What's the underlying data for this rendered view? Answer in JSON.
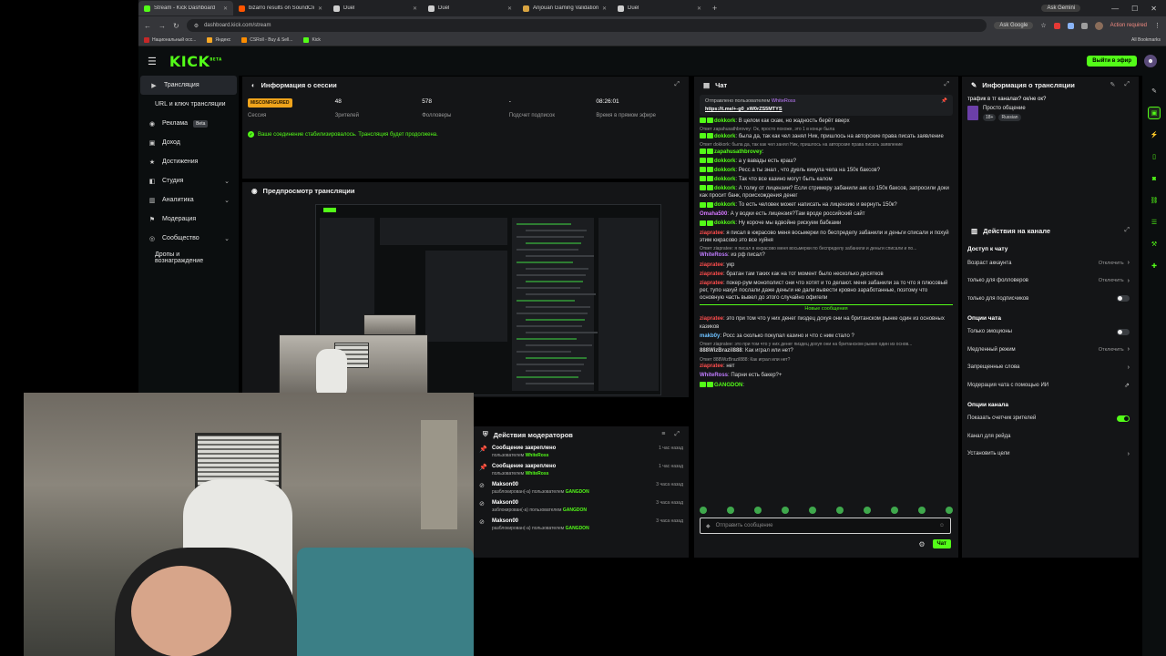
{
  "browser": {
    "tabs": [
      {
        "label": "Stream - Kick Dashboard",
        "color": "#53fc18",
        "active": true
      },
      {
        "label": "bizarro results on SoundCloud",
        "color": "#ff5500",
        "active": false
      },
      {
        "label": "Duel",
        "color": "#cfcfcf",
        "active": false
      },
      {
        "label": "Duel",
        "color": "#cfcfcf",
        "active": false
      },
      {
        "label": "Anjouan Gaming Validation Re...",
        "color": "#d9a441",
        "active": false
      },
      {
        "label": "Duel",
        "color": "#cfcfcf",
        "active": false
      }
    ],
    "url": "dashboard.kick.com/stream",
    "ask_gemini": "Ask Gemini",
    "ask_google": "Ask Google",
    "action_required": "Action required",
    "bookmarks": [
      "Национальный осс...",
      "Яндекс",
      "CSRoll - Buy & Sell...",
      "Kick"
    ],
    "all_bookmarks": "All Bookmarks"
  },
  "header": {
    "logo": "KICK",
    "logo_beta": "BETA",
    "go_live": "Выйти в эфир"
  },
  "sidebar": {
    "items": [
      {
        "label": "Трансляция",
        "icon": "▶",
        "active": true
      },
      {
        "label": "URL и ключ трансляции",
        "icon": "",
        "sub": true
      },
      {
        "label": "Реклама",
        "icon": "◉",
        "badge": "Beta"
      },
      {
        "label": "Доход",
        "icon": "▣"
      },
      {
        "label": "Достижения",
        "icon": "★"
      },
      {
        "label": "Студия",
        "icon": "◧",
        "chev": true
      },
      {
        "label": "Аналитика",
        "icon": "▥",
        "chev": true
      },
      {
        "label": "Модерация",
        "icon": "⚑"
      },
      {
        "label": "Сообщество",
        "icon": "◎",
        "chev": true
      },
      {
        "label": "Дропы и вознаграждение",
        "icon": "",
        "sub": true
      }
    ]
  },
  "session": {
    "title": "Информация о сессии",
    "status": "MISCONFIGURED",
    "stats": [
      {
        "value": "48",
        "label": "Зрителей"
      },
      {
        "value": "578",
        "label": "Фолловеры"
      },
      {
        "value": "-",
        "label": "Подсчет подписок"
      },
      {
        "value": "08:26:01",
        "label": "Время в прямом эфире"
      }
    ],
    "session_label": "Сессия",
    "ok_message": "Ваше соединение стабилизировалось. Трансляция будет продолжена."
  },
  "preview": {
    "title": "Предпросмотр трансляции"
  },
  "mod_actions": {
    "title": "Действия модераторов",
    "rows": [
      {
        "icon": "📌",
        "title": "Сообщение закреплено",
        "sub": "пользователем",
        "user": "WhiteRoss",
        "time": "1 час назад"
      },
      {
        "icon": "📌",
        "title": "Сообщение закреплено",
        "sub": "пользователем",
        "user": "WhiteRoss",
        "time": "1 час назад"
      },
      {
        "icon": "⊘",
        "title": "Makson00",
        "sub": "разблокирован(-а) пользователем",
        "user": "GANGDON",
        "time": "3 часа назад"
      },
      {
        "icon": "⊘",
        "title": "Makson00",
        "sub": "заблокирован(-а) пользователем",
        "user": "GANGDON",
        "time": "3 часа назад"
      },
      {
        "icon": "⊘",
        "title": "Makson00",
        "sub": "разблокирован(-а) пользователем",
        "user": "GANGDON",
        "time": "3 часа назад"
      }
    ]
  },
  "chat": {
    "title": "Чат",
    "pinned_by": "Отправлено пользователем",
    "pinned_user": "WhiteRoss",
    "pinned_link": "https://t.me/+-g0_xW0rZS5MTYS",
    "new_messages": "Новые сообщения",
    "placeholder": "Отправить сообщение",
    "send": "Чат",
    "messages": [
      {
        "reply": "",
        "user": "dokkork",
        "color": "#53fc18",
        "text": "В целом как скам, но жадность берёт вверх"
      },
      {
        "reply": "Ответ zapahusathbrovey: Ок, просто похоже, это 1 в конце была",
        "user": "dokkork",
        "color": "#53fc18",
        "text": "была да, так как чел занял Ник, пришлось на авторские права писать заявление"
      },
      {
        "reply": "Ответ dokkork: была да, так как чел занял Ник, пришлось на авторские права писать заявление",
        "user": "zapahusathbrovey",
        "color": "#53fc18",
        "text": ""
      },
      {
        "reply": "",
        "user": "dokkork",
        "color": "#53fc18",
        "text": "а у вавады есть краш?"
      },
      {
        "reply": "",
        "user": "dokkork",
        "color": "#53fc18",
        "text": "Ресс а ты знал , что дуель кинула чела на 150к баксов?"
      },
      {
        "reply": "",
        "user": "dokkork",
        "color": "#53fc18",
        "text": "Так что все казино могут быть калом"
      },
      {
        "reply": "",
        "user": "dokkork",
        "color": "#53fc18",
        "text": "А толку от лицензии? Если стримеру забанили акк со 150к баксов, запросили доки как просит банк, происхождения денег"
      },
      {
        "reply": "",
        "user": "dokkork",
        "color": "#53fc18",
        "text": "То есть человек может написать на лицензию и вернуть 150к?"
      },
      {
        "reply": "",
        "user": "Omaha500",
        "color": "#d676ff",
        "text": "А у водки есть лицензия?Там вроде российский сайт"
      },
      {
        "reply": "",
        "user": "dokkork",
        "color": "#53fc18",
        "text": "Ну короче мы вдвойне рискуем бабками"
      },
      {
        "reply": "",
        "user": "ziapratee",
        "color": "#ff4d4d",
        "text": "я писал в юкрасово меня восьмерки по беспределу забанили и деньги списали и похуй этим юкрасово это все хуйня"
      },
      {
        "reply": "Ответ ziapratee: я писал в юкрасово меня восьмерки по беспределу забанили и деньги списали и по...",
        "user": "WhiteRoss",
        "color": "#c07cff",
        "text": "из рф писал?"
      },
      {
        "reply": "",
        "user": "ziapratee",
        "color": "#ff4d4d",
        "text": "укр"
      },
      {
        "reply": "",
        "user": "ziapratee",
        "color": "#ff4d4d",
        "text": "братан там таких как на тот момент было несколько десятков"
      },
      {
        "reply": "",
        "user": "ziapratee",
        "color": "#ff4d4d",
        "text": "покер-рум монополист они что хотят и то делают. меня забанили за то что я плюсовый рег, тупо нахуй послали даже деньги не дали вывести кровно заработанные, поэтому что основную часть вывел до этого случайно офигели"
      },
      {
        "divider": true
      },
      {
        "reply": "",
        "user": "ziapratee",
        "color": "#ff4d4d",
        "text": "это при том что у них денег пиздец дохуя они на британском рынке один из основных казиков"
      },
      {
        "reply": "",
        "user": "makb0y",
        "color": "#6ec1ff",
        "text": "Росс за сколько покупал казино и что с ним стало ?"
      },
      {
        "reply": "Ответ ziapratee: это при том что у них денег пиздец дохуя они на британском рынке один из основ...",
        "user": "888WizBrazil888",
        "color": "#cfcfcf",
        "text": "Как играл или нет?"
      },
      {
        "reply": "Ответ 888WizBrazil888: Как играл или нет?",
        "user": "ziapratee",
        "color": "#ff4d4d",
        "text": "нет"
      },
      {
        "reply": "",
        "user": "WhiteRoss",
        "color": "#c07cff",
        "text": "Парни есть бакер?+"
      },
      {
        "reply": "",
        "user": "GANGDON",
        "color": "#53fc18",
        "text": ""
      }
    ]
  },
  "stream_info": {
    "title": "Информация о трансляции",
    "stream_title": "трафик в тг каналах? ок/не ок?",
    "category": "Просто общение",
    "tags": [
      "18+",
      "Russian"
    ]
  },
  "channel_actions": {
    "title": "Действия на канале",
    "sections": [
      {
        "title": "Доступ к чату",
        "rows": [
          {
            "label": "Возраст аккаунта",
            "value": "Отключить",
            "kind": "chev"
          },
          {
            "label": "только для фолловеров",
            "value": "Отключить",
            "kind": "chev"
          },
          {
            "label": "только для подписчиков",
            "value": "",
            "kind": "toggle",
            "on": false
          }
        ]
      },
      {
        "title": "Опции чата",
        "rows": [
          {
            "label": "Только эмоционы",
            "value": "",
            "kind": "toggle",
            "on": false
          },
          {
            "label": "Медленный режим",
            "value": "Отключить",
            "kind": "chev"
          },
          {
            "label": "Запрещенные слова",
            "value": "",
            "kind": "chev"
          },
          {
            "label": "Модерация чата с помощью ИИ",
            "value": "",
            "kind": "ext"
          }
        ]
      },
      {
        "title": "Опции канала",
        "rows": [
          {
            "label": "Показать счетчик зрителей",
            "value": "",
            "kind": "toggle",
            "on": true
          },
          {
            "label": "Канал для рейда",
            "value": "",
            "kind": "none"
          },
          {
            "label": "Установить цели",
            "value": "",
            "kind": "chev"
          }
        ]
      }
    ]
  }
}
